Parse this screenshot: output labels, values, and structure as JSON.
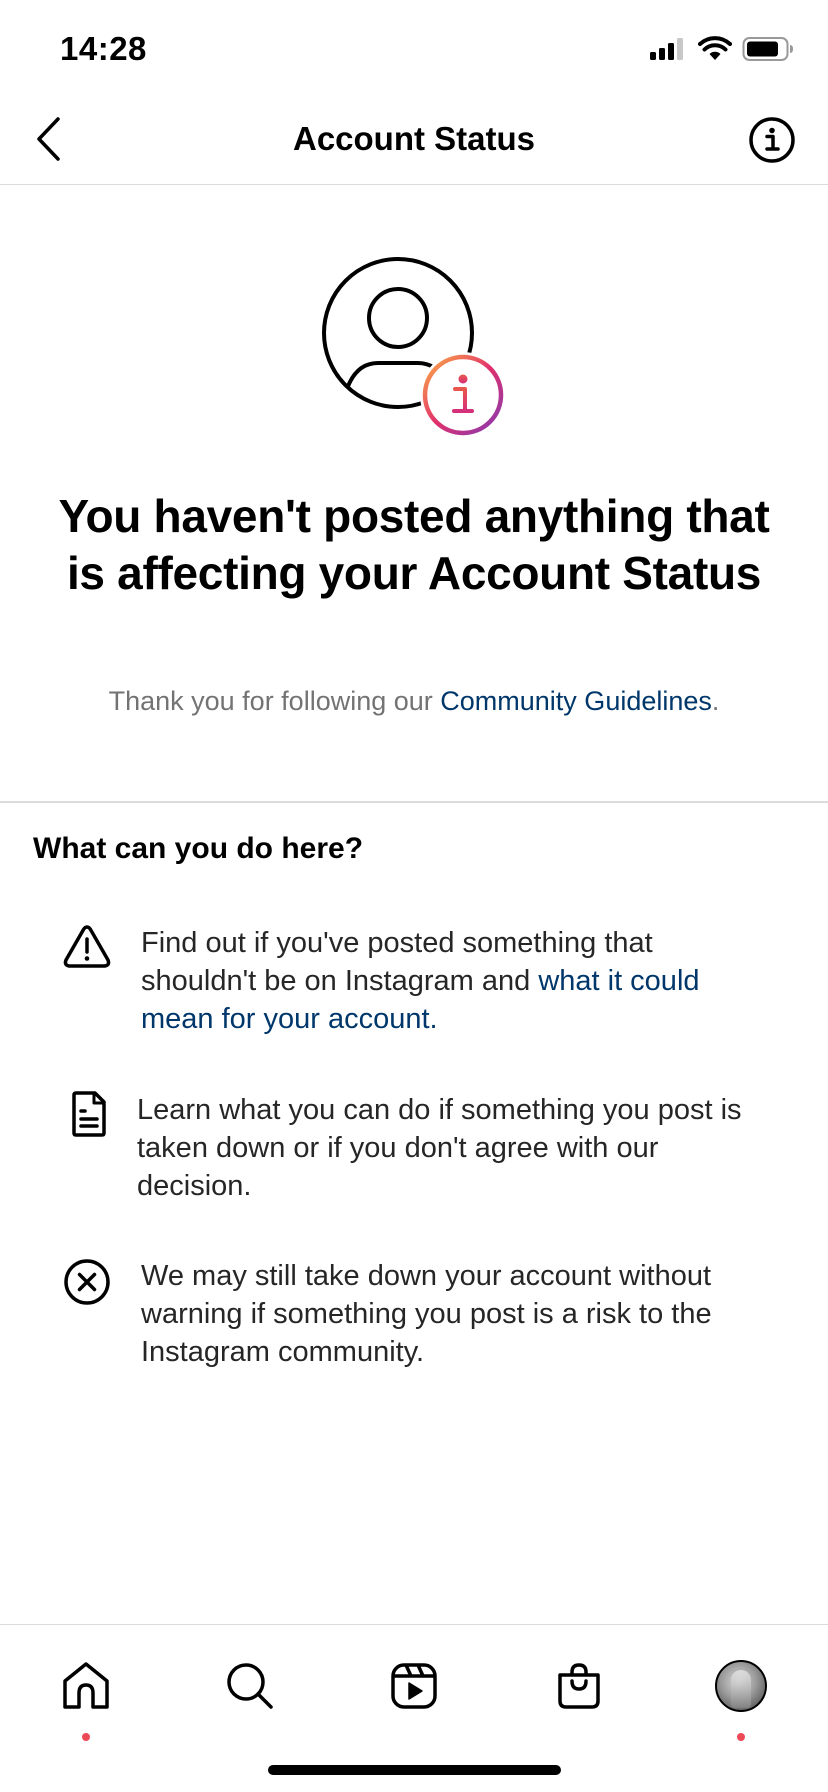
{
  "status_bar": {
    "time": "14:28",
    "icons": [
      "cellular-signal-icon",
      "wifi-icon",
      "battery-icon"
    ]
  },
  "header": {
    "title": "Account Status",
    "back_icon": "chevron-left-icon",
    "info_icon": "info-circle-icon"
  },
  "hero": {
    "icon": "account-info-icon",
    "title": "You haven't posted anything that is affecting your Account Status",
    "subtitle_prefix": "Thank you for following our ",
    "subtitle_link": "Community Guidelines",
    "subtitle_suffix": "."
  },
  "section": {
    "title": "What can you do here?",
    "items": [
      {
        "icon": "warning-triangle-icon",
        "text": "Find out if you've posted something that shouldn't be on Instagram and ",
        "link": "what it could mean for your account."
      },
      {
        "icon": "document-icon",
        "text": "Learn what you can do if something you post is taken down or if you don't agree with our decision.",
        "link": ""
      },
      {
        "icon": "close-circle-icon",
        "text": "We may still take down your account without warning if something you post is a risk to the Instagram community.",
        "link": ""
      }
    ]
  },
  "tab_bar": {
    "tabs": [
      {
        "name": "home",
        "icon": "home-icon",
        "has_dot": true
      },
      {
        "name": "search",
        "icon": "search-icon",
        "has_dot": false
      },
      {
        "name": "reels",
        "icon": "reels-icon",
        "has_dot": false
      },
      {
        "name": "shop",
        "icon": "shopping-bag-icon",
        "has_dot": false
      },
      {
        "name": "profile",
        "icon": "profile-avatar",
        "has_dot": true
      }
    ]
  },
  "colors": {
    "link": "#00376b",
    "secondary_text": "#737373",
    "notification_dot": "#ed4956",
    "divider": "#dbdbdb",
    "gradient": [
      "#fcaf45",
      "#e1306c",
      "#833ab4"
    ]
  }
}
